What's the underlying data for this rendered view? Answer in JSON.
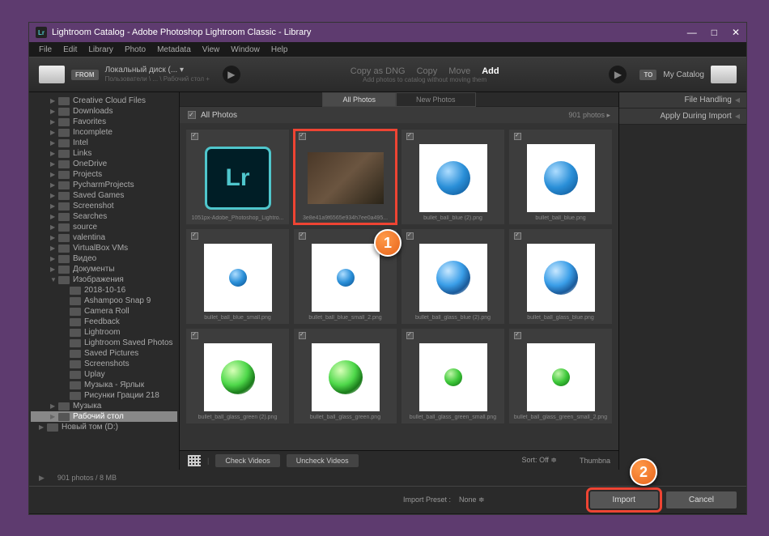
{
  "window": {
    "title": "Lightroom Catalog - Adobe Photoshop Lightroom Classic - Library"
  },
  "menu": [
    "File",
    "Edit",
    "Library",
    "Photo",
    "Metadata",
    "View",
    "Window",
    "Help"
  ],
  "header": {
    "from_badge": "FROM",
    "from_label": "Локальный диск (... ▾",
    "from_path": "Пользователи \\ ... \\ Рабочий стол +",
    "ops": {
      "dng": "Copy as DNG",
      "copy": "Copy",
      "move": "Move",
      "add": "Add"
    },
    "ops_sub": "Add photos to catalog without moving them",
    "to_badge": "TO",
    "to_label": "My Catalog"
  },
  "tree": [
    {
      "label": "Creative Cloud Files",
      "depth": 2,
      "state": "collapsed"
    },
    {
      "label": "Downloads",
      "depth": 2,
      "state": "collapsed"
    },
    {
      "label": "Favorites",
      "depth": 2,
      "state": "collapsed"
    },
    {
      "label": "Incomplete",
      "depth": 2,
      "state": "collapsed"
    },
    {
      "label": "Intel",
      "depth": 2,
      "state": "collapsed"
    },
    {
      "label": "Links",
      "depth": 2,
      "state": "collapsed"
    },
    {
      "label": "OneDrive",
      "depth": 2,
      "state": "collapsed"
    },
    {
      "label": "Projects",
      "depth": 2,
      "state": "collapsed"
    },
    {
      "label": "PycharmProjects",
      "depth": 2,
      "state": "collapsed"
    },
    {
      "label": "Saved Games",
      "depth": 2,
      "state": "collapsed"
    },
    {
      "label": "Screenshot",
      "depth": 2,
      "state": "collapsed"
    },
    {
      "label": "Searches",
      "depth": 2,
      "state": "collapsed"
    },
    {
      "label": "source",
      "depth": 2,
      "state": "collapsed"
    },
    {
      "label": "valentina",
      "depth": 2,
      "state": "collapsed"
    },
    {
      "label": "VirtualBox VMs",
      "depth": 2,
      "state": "collapsed"
    },
    {
      "label": "Видео",
      "depth": 2,
      "state": "collapsed"
    },
    {
      "label": "Документы",
      "depth": 2,
      "state": "collapsed"
    },
    {
      "label": "Изображения",
      "depth": 2,
      "state": "expanded"
    },
    {
      "label": "2018-10-16",
      "depth": 3,
      "state": "none"
    },
    {
      "label": "Ashampoo Snap 9",
      "depth": 3,
      "state": "none"
    },
    {
      "label": "Camera Roll",
      "depth": 3,
      "state": "none"
    },
    {
      "label": "Feedback",
      "depth": 3,
      "state": "none"
    },
    {
      "label": "Lightroom",
      "depth": 3,
      "state": "none"
    },
    {
      "label": "Lightroom Saved Photos",
      "depth": 3,
      "state": "none"
    },
    {
      "label": "Saved Pictures",
      "depth": 3,
      "state": "none"
    },
    {
      "label": "Screenshots",
      "depth": 3,
      "state": "none"
    },
    {
      "label": "Uplay",
      "depth": 3,
      "state": "none"
    },
    {
      "label": "Музыка - Ярлык",
      "depth": 3,
      "state": "none"
    },
    {
      "label": "Рисунки Грации 218",
      "depth": 3,
      "state": "none"
    },
    {
      "label": "Музыка",
      "depth": 2,
      "state": "collapsed"
    },
    {
      "label": "Рабочий стол",
      "depth": 2,
      "state": "collapsed",
      "selected": true
    },
    {
      "label": "Новый том (D:)",
      "depth": 1,
      "state": "collapsed"
    }
  ],
  "tabs": {
    "all": "All Photos",
    "new": "New Photos"
  },
  "all_photos": {
    "label": "All Photos",
    "count": "901 photos"
  },
  "thumbs": [
    {
      "label": "1051px-Adobe_Photoshop_Lightro...",
      "kind": "lr"
    },
    {
      "label": "3e8e41a9f6565e934h7ee0a495...",
      "kind": "photo",
      "hl": true
    },
    {
      "label": "bullet_ball_blue (2).png",
      "kind": "blue"
    },
    {
      "label": "bullet_ball_blue.png",
      "kind": "blue"
    },
    {
      "label": "bullet_ball_blue_small.png",
      "kind": "blue-sm"
    },
    {
      "label": "bullet_ball_blue_small_2.png",
      "kind": "blue-sm"
    },
    {
      "label": "bullet_ball_glass_blue (2).png",
      "kind": "blue-glass"
    },
    {
      "label": "bullet_ball_glass_blue.png",
      "kind": "blue-glass"
    },
    {
      "label": "bullet_ball_glass_green (2).png",
      "kind": "green-glass"
    },
    {
      "label": "bullet_ball_glass_green.png",
      "kind": "green-glass"
    },
    {
      "label": "bullet_ball_glass_green_small.png",
      "kind": "green-sm"
    },
    {
      "label": "bullet_ball_glass_green_small_2.png",
      "kind": "green-sm"
    }
  ],
  "toolbar": {
    "check": "Check Videos",
    "uncheck": "Uncheck Videos",
    "sort_label": "Sort:",
    "sort_value": "Off",
    "thumb_label": "Thumbna"
  },
  "right_panels": [
    "File Handling",
    "Apply During Import"
  ],
  "status": "901 photos / 8 MB",
  "bottom": {
    "preset_label": "Import Preset :",
    "preset_value": "None",
    "import": "Import",
    "cancel": "Cancel"
  },
  "callouts": {
    "one": "1",
    "two": "2"
  }
}
